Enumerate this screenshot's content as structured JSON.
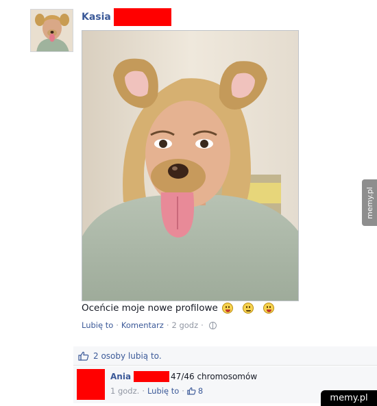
{
  "post": {
    "author_name": "Kasia",
    "caption": "Oceńcie moje nowe profilowe",
    "actions": {
      "like_label": "Lubię to",
      "comment_label": "Komentarz",
      "time": "2 godz"
    },
    "likes_text": "2 osoby lubią to."
  },
  "comment": {
    "author_name": "Ania",
    "text": "47/46 chromosomów",
    "time": "1 godz.",
    "like_label": "Lubię to",
    "like_count": "8"
  },
  "watermarks": {
    "side": "memy.pl",
    "bottom": "memy.pl"
  },
  "colors": {
    "link": "#3b5998",
    "muted": "#9197a3",
    "redaction": "#ff0000",
    "panel": "#f6f7f9"
  },
  "icons": [
    "thumbs-up-icon",
    "globe-icon",
    "emoji-icon"
  ]
}
